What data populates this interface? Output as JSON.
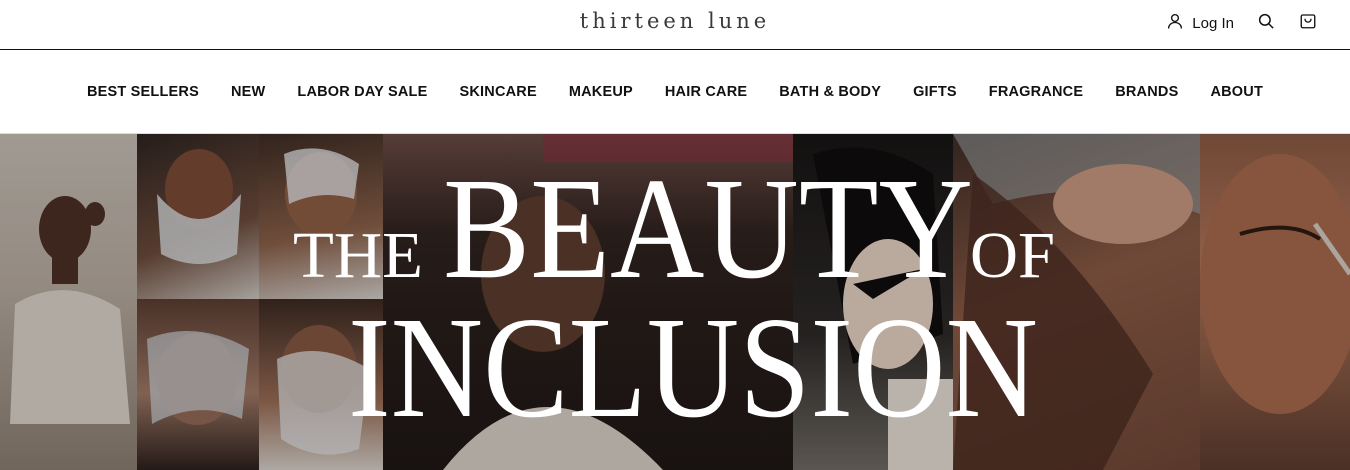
{
  "brand": {
    "logo_text": "thirteen lune"
  },
  "header": {
    "login_label": "Log In",
    "icons": [
      "user-icon",
      "search-icon",
      "cart-icon"
    ]
  },
  "nav": {
    "items": [
      {
        "label": "BEST SELLERS"
      },
      {
        "label": "NEW"
      },
      {
        "label": "LABOR DAY SALE"
      },
      {
        "label": "SKINCARE"
      },
      {
        "label": "MAKEUP"
      },
      {
        "label": "HAIR CARE"
      },
      {
        "label": "BATH & BODY"
      },
      {
        "label": "GIFTS"
      },
      {
        "label": "FRAGRANCE"
      },
      {
        "label": "BRANDS"
      },
      {
        "label": "ABOUT"
      }
    ]
  },
  "hero": {
    "line1_small_left": "THE",
    "line1_big": "BEAUTY",
    "line1_small_right": "OF",
    "line2_big": "INCLUSION",
    "colors": {
      "text": "#ffffff",
      "overlay": "#1e1715"
    }
  }
}
